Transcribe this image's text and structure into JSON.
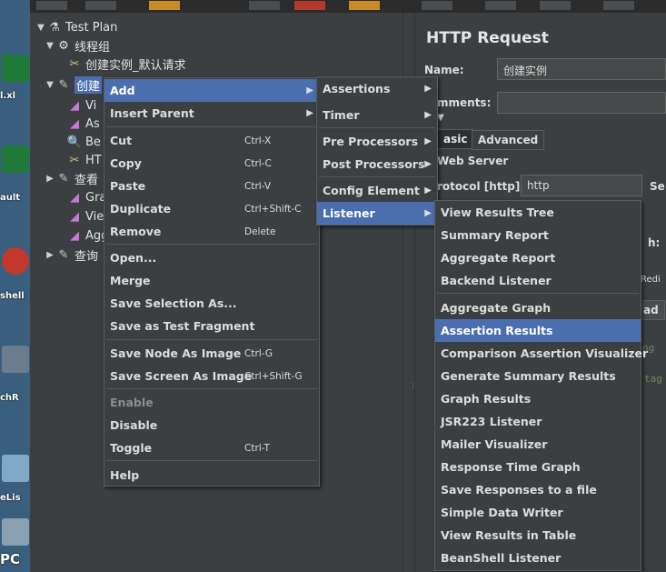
{
  "desktop": {
    "labels": [
      "l.xl",
      "ault",
      "shell",
      "chR",
      "eLis",
      "PC"
    ]
  },
  "tree": {
    "test_plan": "Test Plan",
    "thread_group": "线程组",
    "default_request": "创建实例_默认请求",
    "selected_sampler": "创建",
    "child_vi": "Vi",
    "child_as": "As",
    "child_be": "Be",
    "child_ht": "HT",
    "child_query1": "查看",
    "child_gra": "Gra",
    "child_vie": "Vie",
    "child_agg": "Agg",
    "child_query2": "查询"
  },
  "panel": {
    "title": "HTTP Request",
    "name_label": "Name:",
    "name_value": "创建实例",
    "comments_label": "mments:",
    "tab_basic": "asic",
    "tab_advanced": "Advanced",
    "web_server": "Web Server",
    "protocol_label": "rotocol [http]:",
    "protocol_value": "http",
    "se_label": "Se",
    "h_label": "h:",
    "redi_label": "Redi",
    "ad_label": "ad",
    "code1": "ng",
    "code2": "tag"
  },
  "context_menu": {
    "items": [
      {
        "label": "Add",
        "submenu": true,
        "highlight": true
      },
      {
        "label": "Insert Parent",
        "submenu": true
      },
      {
        "label": "Cut",
        "shortcut": "Ctrl-X"
      },
      {
        "label": "Copy",
        "shortcut": "Ctrl-C"
      },
      {
        "label": "Paste",
        "shortcut": "Ctrl-V"
      },
      {
        "label": "Duplicate",
        "shortcut": "Ctrl+Shift-C"
      },
      {
        "label": "Remove",
        "shortcut": "Delete"
      },
      {
        "label": "Open..."
      },
      {
        "label": "Merge"
      },
      {
        "label": "Save Selection As..."
      },
      {
        "label": "Save as Test Fragment"
      },
      {
        "label": "Save Node As Image",
        "shortcut": "Ctrl-G"
      },
      {
        "label": "Save Screen As Image",
        "shortcut": "Ctrl+Shift-G"
      },
      {
        "label": "Enable",
        "disabled": true
      },
      {
        "label": "Disable"
      },
      {
        "label": "Toggle",
        "shortcut": "Ctrl-T"
      },
      {
        "label": "Help"
      }
    ]
  },
  "add_menu": {
    "items": [
      {
        "label": "Assertions"
      },
      {
        "label": "Timer"
      },
      {
        "label": "Pre Processors"
      },
      {
        "label": "Post Processors"
      },
      {
        "label": "Config Element"
      },
      {
        "label": "Listener",
        "highlight": true
      }
    ]
  },
  "listener_menu": {
    "items": [
      {
        "label": "View Results Tree"
      },
      {
        "label": "Summary Report"
      },
      {
        "label": "Aggregate Report"
      },
      {
        "label": "Backend Listener"
      },
      {
        "label": "Aggregate Graph"
      },
      {
        "label": "Assertion Results",
        "highlight": true
      },
      {
        "label": "Comparison Assertion Visualizer"
      },
      {
        "label": "Generate Summary Results"
      },
      {
        "label": "Graph Results"
      },
      {
        "label": "JSR223 Listener"
      },
      {
        "label": "Mailer Visualizer"
      },
      {
        "label": "Response Time Graph"
      },
      {
        "label": "Save Responses to a file"
      },
      {
        "label": "Simple Data Writer"
      },
      {
        "label": "View Results in Table"
      },
      {
        "label": "BeanShell Listener"
      }
    ]
  },
  "colors": {
    "background": "#3c3f41",
    "highlight": "#4b6eaf",
    "text": "#dcdcdc",
    "disabled": "#8c8c8c"
  }
}
